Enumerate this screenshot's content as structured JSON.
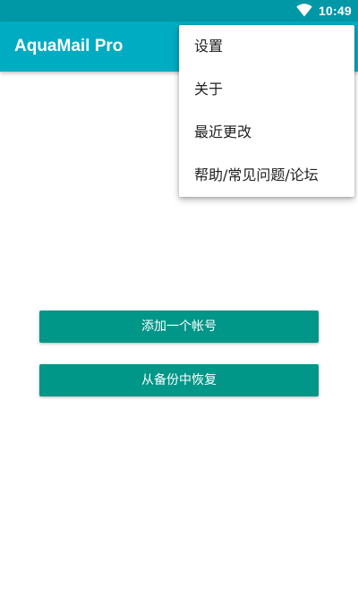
{
  "status_bar": {
    "time": "10:49",
    "wifi_icon": "wifi-icon",
    "background_color": "#0097a7"
  },
  "app_bar": {
    "title": "AquaMail Pro",
    "background_color": "#00acc1"
  },
  "main": {
    "add_account_label": "添加一个帐号",
    "restore_backup_label": "从备份中恢复",
    "button_color": "#009688"
  },
  "overflow_menu": {
    "items": [
      {
        "label": "设置"
      },
      {
        "label": "关于"
      },
      {
        "label": "最近更改"
      },
      {
        "label": "帮助/常见问题/论坛"
      }
    ]
  }
}
